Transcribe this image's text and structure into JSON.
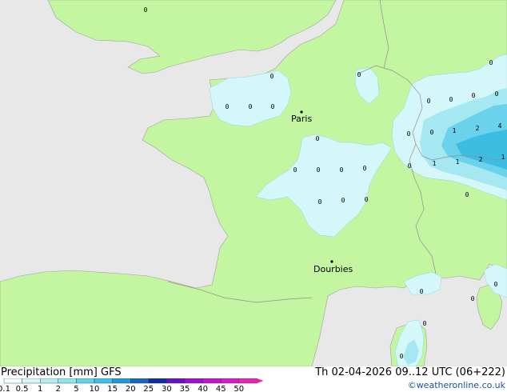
{
  "footer": {
    "title": "Precipitation [mm] GFS",
    "datetime": "Th 02-04-2026 09..12 UTC (06+222)",
    "credit": "©weatheronline.co.uk"
  },
  "legend": {
    "labels": [
      "0.1",
      "0.5",
      "1",
      "2",
      "5",
      "10",
      "15",
      "20",
      "25",
      "30",
      "35",
      "40",
      "45",
      "50"
    ],
    "colors": [
      "#f2ffff",
      "#d4f6f8",
      "#b0eef2",
      "#8ee5f0",
      "#60d4ec",
      "#3cc2e6",
      "#1e9ad6",
      "#1466c2",
      "#0a2fa8",
      "#6a10c8",
      "#a010d8",
      "#c812d0",
      "#e014c8",
      "#f020b0"
    ]
  },
  "map": {
    "colors": {
      "sea": "#e8e8e8",
      "land": "#c4f5a0",
      "precip_light": "#d6f7fa",
      "precip_mid": "#a6e8f2",
      "precip_strong": "#6ad2ea",
      "precip_heavy": "#3cbde2",
      "border": "#a0a0a0"
    },
    "cities": [
      {
        "name": "Paris"
      },
      {
        "name": "Dourbies"
      }
    ],
    "values": [
      "0",
      "0",
      "0",
      "0",
      "0",
      "0",
      "0",
      "0",
      "0",
      "0",
      "0",
      "0",
      "0",
      "0",
      "0",
      "0",
      "0",
      "0",
      "0",
      "0",
      "0",
      "0",
      "1",
      "2",
      "4",
      "1",
      "1",
      "2",
      "1",
      "0",
      "0",
      "0",
      "0",
      "0",
      "0"
    ]
  }
}
